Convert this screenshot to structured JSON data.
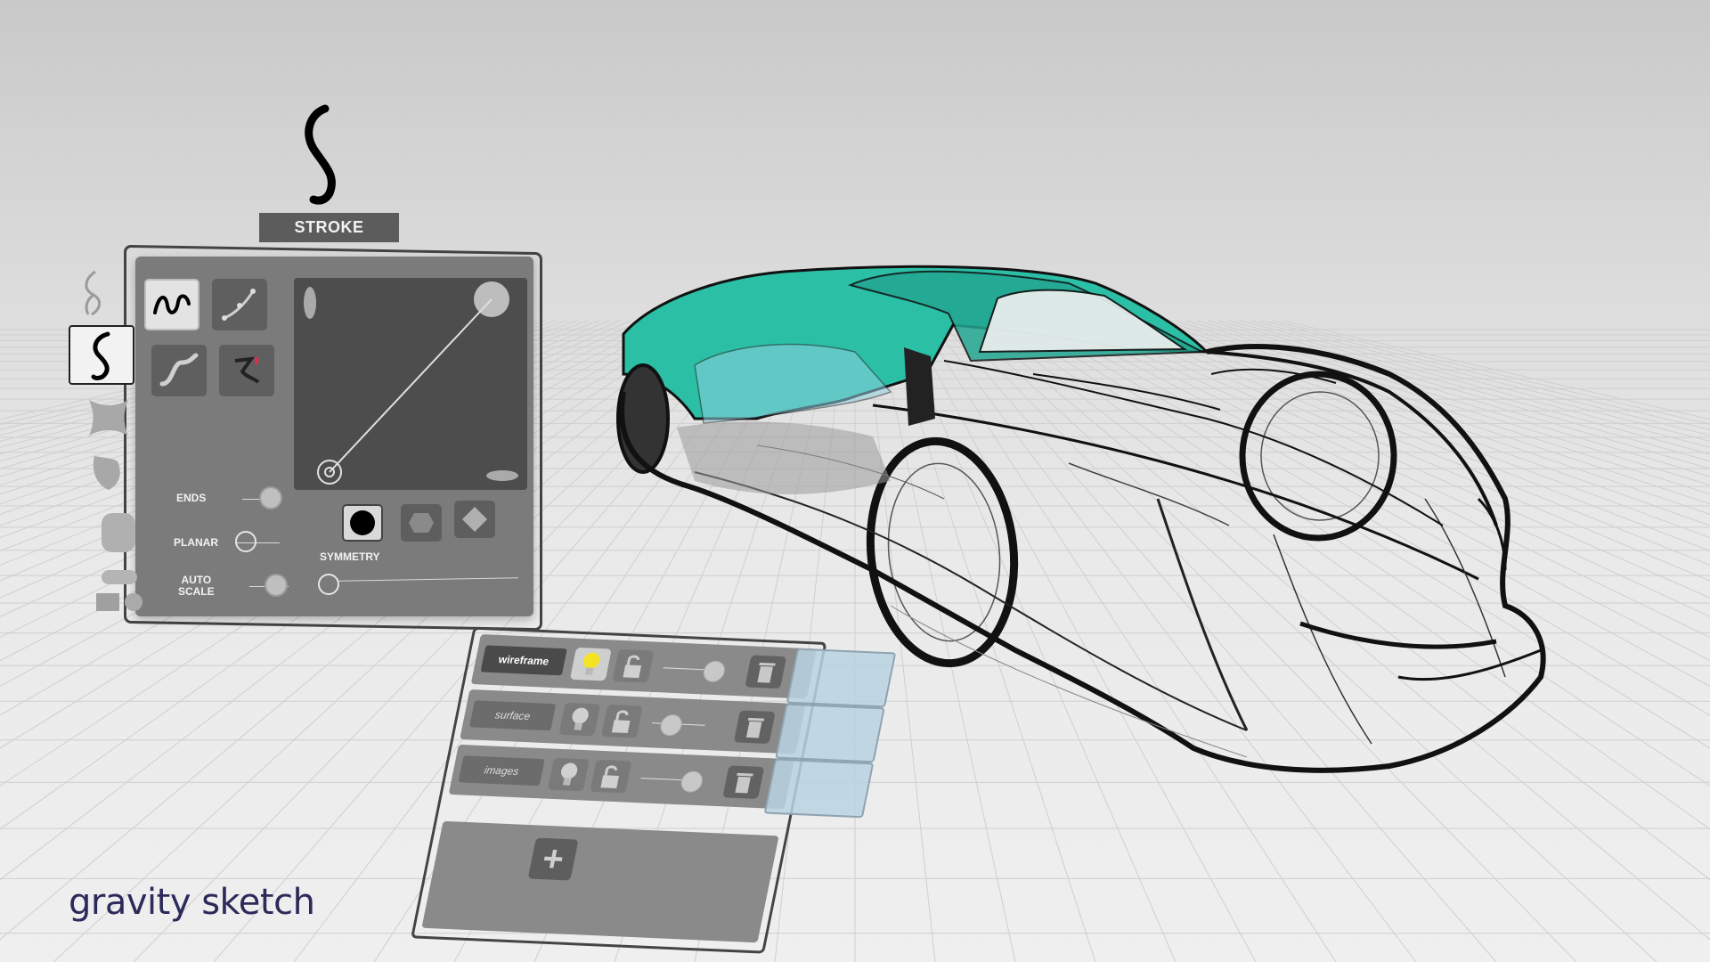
{
  "stroke_panel": {
    "header": "STROKE",
    "ends_label": "ENDS",
    "planar_label": "PLANAR",
    "auto_scale_label_1": "AUTO",
    "auto_scale_label_2": "SCALE",
    "symmetry_label": "SYMMETRY"
  },
  "layers_panel": {
    "layers": [
      {
        "name": "wireframe",
        "visible_light": "on"
      },
      {
        "name": "surface",
        "visible_light": "off"
      },
      {
        "name": "images",
        "visible_light": "off"
      }
    ],
    "add_label": "+"
  },
  "branding": {
    "logo_text": "gravity sketch",
    "logo_color": "#2b2a5a"
  },
  "colors": {
    "car_surface": "#2bbfa6",
    "car_surface_dark": "#1e9886",
    "panel_gray": "#7b7b7b",
    "bulb_yellow": "#f3e322"
  }
}
